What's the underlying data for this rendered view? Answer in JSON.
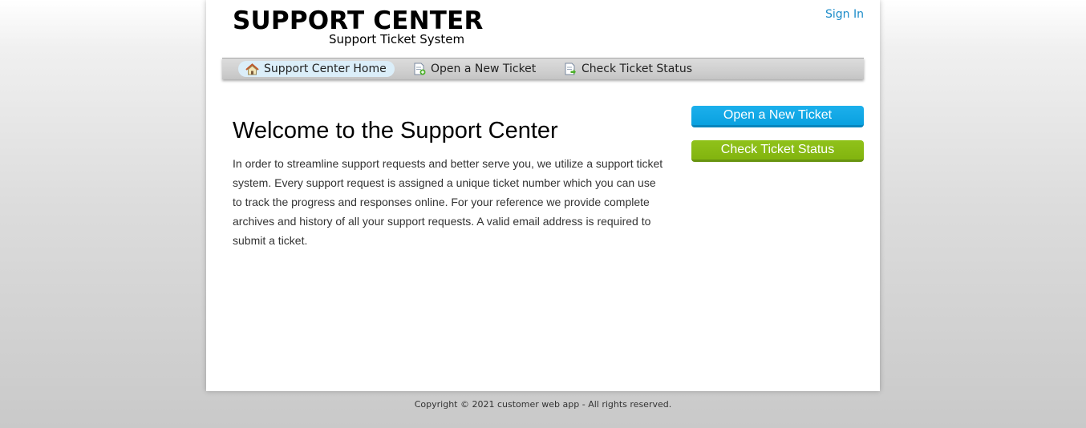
{
  "header": {
    "logo_title": "SUPPORT CENTER",
    "logo_subtitle": "Support Ticket System",
    "sign_in_label": "Sign In"
  },
  "nav": {
    "items": [
      {
        "label": "Support Center Home",
        "icon": "home-icon",
        "active": true
      },
      {
        "label": "Open a New Ticket",
        "icon": "new-ticket-icon",
        "active": false
      },
      {
        "label": "Check Ticket Status",
        "icon": "ticket-status-icon",
        "active": false
      }
    ]
  },
  "main": {
    "title": "Welcome to the Support Center",
    "body": "In order to streamline support requests and better serve you, we utilize a support ticket system. Every support request is assigned a unique ticket number which you can use to track the progress and responses online. For your reference we provide complete archives and history of all your support requests. A valid email address is required to submit a ticket."
  },
  "sidebar": {
    "open_ticket_label": "Open a New Ticket",
    "check_status_label": "Check Ticket Status"
  },
  "footer": {
    "copyright": "Copyright © 2021 customer web app - All rights reserved."
  },
  "colors": {
    "link": "#1a8bc9",
    "open_button": "#0aa1e0",
    "check_button": "#82b40f",
    "active_nav": "#dbeef9"
  }
}
